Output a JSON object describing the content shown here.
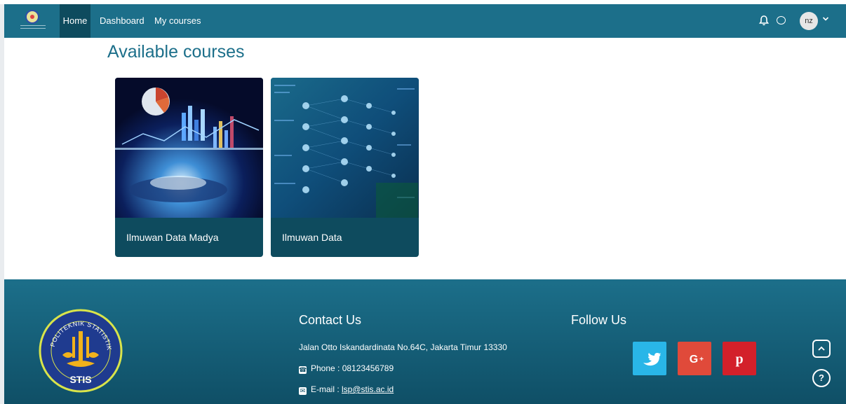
{
  "navbar": {
    "logo_alt": "Lembaga Sertifikasi Profesi",
    "items": [
      {
        "label": "Home"
      },
      {
        "label": "Dashboard"
      },
      {
        "label": "My courses"
      }
    ],
    "user_initials": "nz",
    "icons": [
      "bell-icon",
      "chat-icon",
      "chevron-down-icon"
    ],
    "bg_color": "#1c6f8a",
    "active_color": "#0e4b5e"
  },
  "main": {
    "title": "Available courses",
    "courses": [
      {
        "title": "Ilmuwan Data Madya"
      },
      {
        "title": "Ilmuwan Data"
      }
    ]
  },
  "footer": {
    "logo_text": "POLITEKNIK STATISTIKA",
    "logo_short": "STIS",
    "contact": {
      "heading": "Contact Us",
      "address": "Jalan Otto Iskandardinata No.64C, Jakarta Timur 13330",
      "phone_label": "Phone : 08123456789",
      "email_label": "E-mail : ",
      "email": "lsp@stis.ac.id"
    },
    "follow": {
      "heading": "Follow Us",
      "icons": [
        "twitter-icon",
        "google-plus-icon",
        "pinterest-icon"
      ]
    },
    "help_label": "?"
  }
}
